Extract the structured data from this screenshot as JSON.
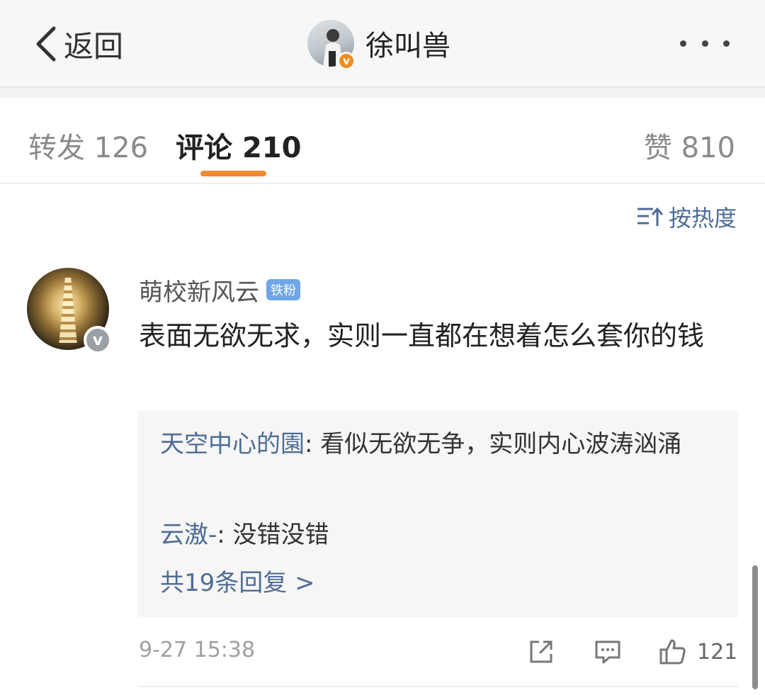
{
  "header": {
    "back_label": "返回",
    "title": "徐叫兽",
    "verified_mark": "v",
    "icons": {
      "back": "chevron-left-icon",
      "more": "more-horizontal-icon"
    }
  },
  "tabs": {
    "repost": {
      "label": "转发",
      "count": "126"
    },
    "comment": {
      "label": "评论",
      "count": "210",
      "active": true
    },
    "like": {
      "label": "赞",
      "count": "810"
    },
    "accent_color": "#f18a2b"
  },
  "sort": {
    "label": "按热度",
    "icon": "sort-icon"
  },
  "comment": {
    "author": "萌校新风云",
    "verified_mark": "v",
    "badge": "铁粉",
    "text": "表面无欲无求，实则一直都在想着怎么套你的钱",
    "replies": [
      {
        "user": "天空中心的園",
        "separator": ": ",
        "text": "看似无欲无争，实则内心波涛汹涌"
      },
      {
        "user": "云滶-",
        "separator": ": ",
        "text": "没错没错"
      }
    ],
    "more_replies": "共19条回复 >",
    "time": "9-27 15:38",
    "likes": "121",
    "action_icons": [
      "share-icon",
      "comment-icon",
      "thumbs-up-icon"
    ],
    "link_color": "#4f6d95"
  }
}
